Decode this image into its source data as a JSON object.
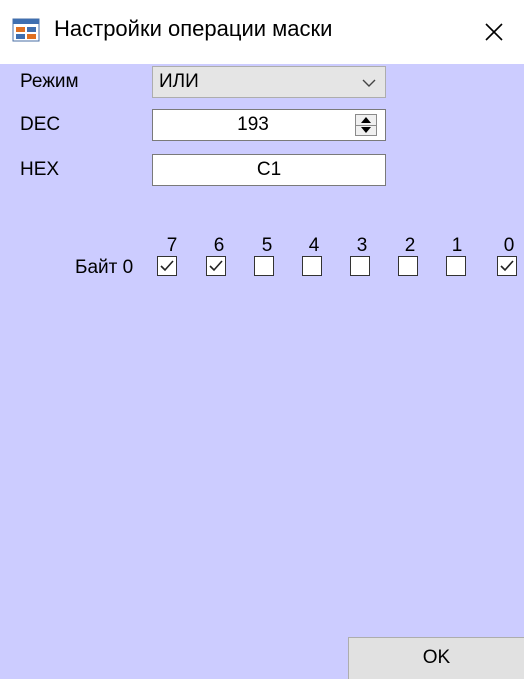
{
  "window": {
    "title": "Настройки операции маски",
    "background": "#ccccff"
  },
  "icons": {
    "title": "app-window-icon",
    "close": "close-icon",
    "combo_arrow": "chevron-down-icon",
    "spin_up": "triangle-up-icon",
    "spin_down": "triangle-down-icon",
    "checkbox_mark": "check-icon"
  },
  "form": {
    "mode": {
      "label": "Режим",
      "value": "ИЛИ"
    },
    "dec": {
      "label": "DEC",
      "value": "193"
    },
    "hex": {
      "label": "HEX",
      "value": "C1"
    }
  },
  "bits": {
    "numbers": [
      "7",
      "6",
      "5",
      "4",
      "3",
      "2",
      "1",
      "0"
    ],
    "byte_label": "Байт 0",
    "checked": [
      true,
      true,
      false,
      false,
      false,
      false,
      false,
      true
    ]
  },
  "buttons": {
    "ok": "OK"
  }
}
